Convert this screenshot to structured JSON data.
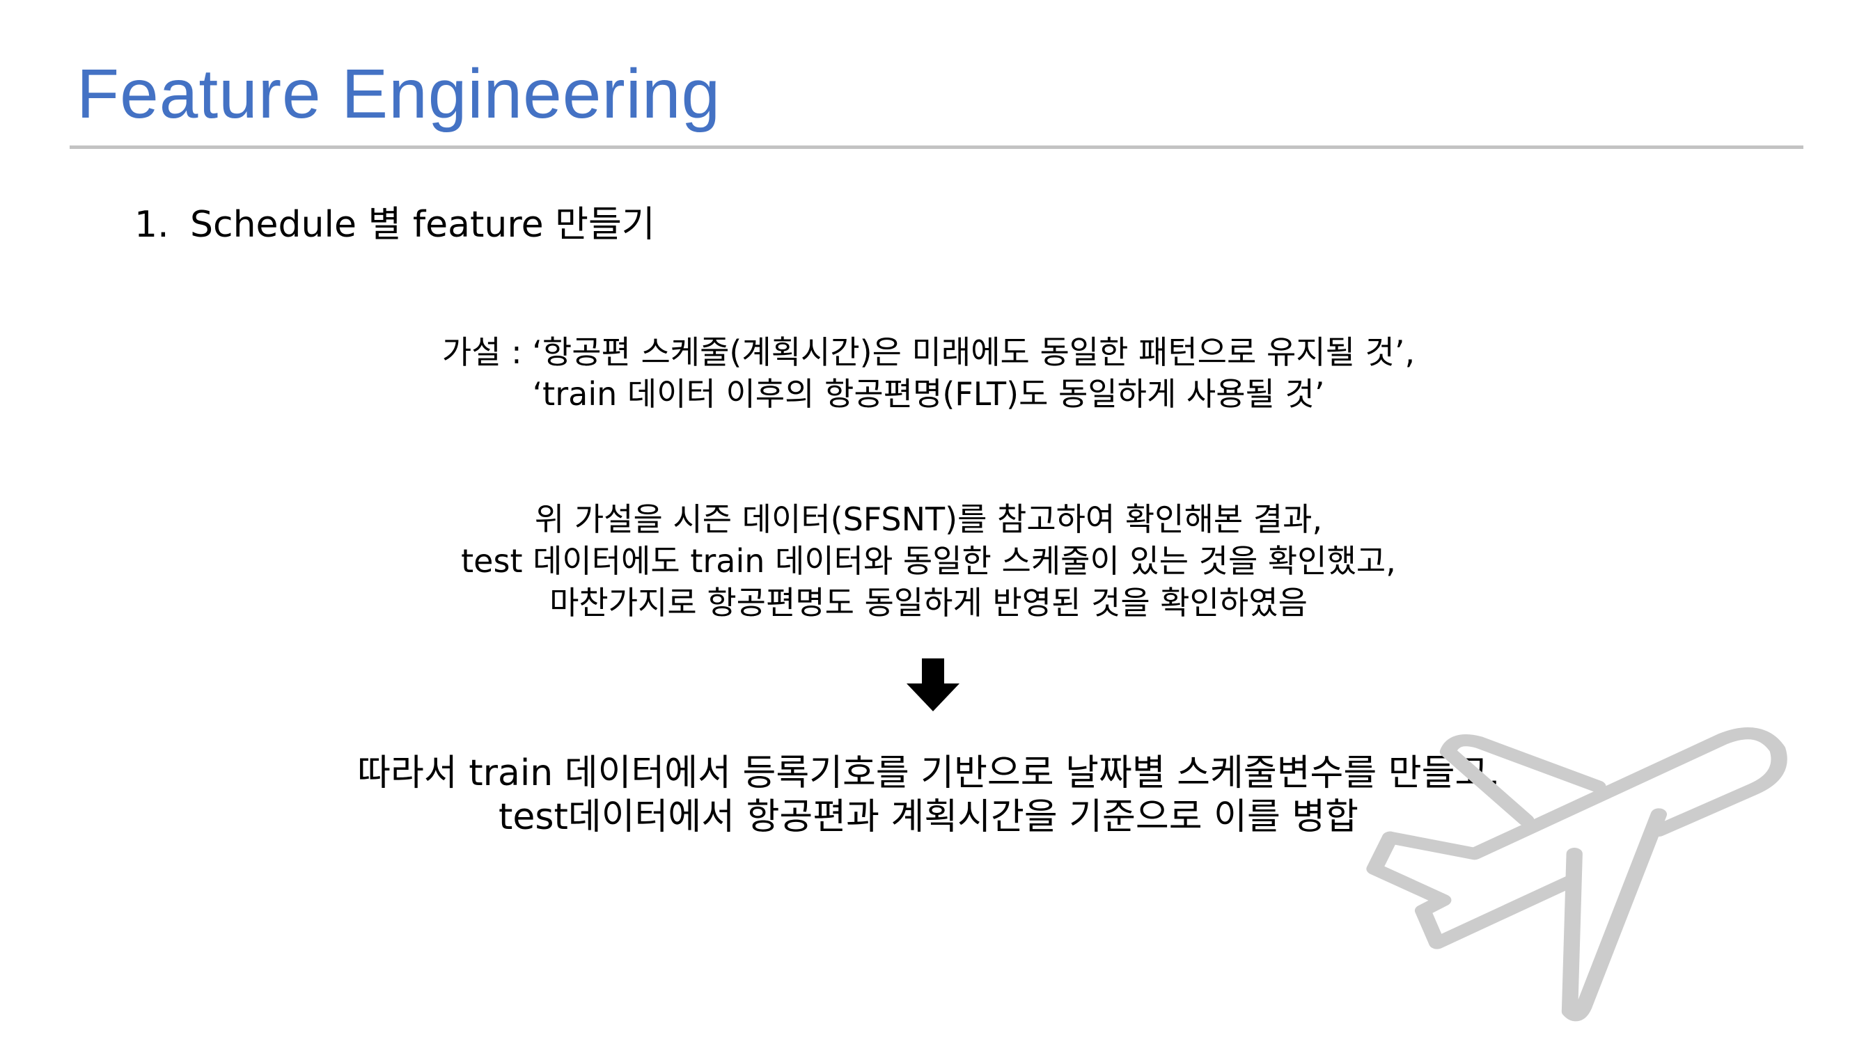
{
  "slide": {
    "title": "Feature Engineering",
    "accent_color": "#4472c4",
    "section": {
      "number": "1.",
      "label": "Schedule 별 feature 만들기"
    },
    "hypothesis": [
      "가설 : ‘항공편 스케줄(계획시간)은 미래에도 동일한 패턴으로 유지될 것’,",
      "‘train 데이터 이후의 항공편명(FLT)도 동일하게 사용될 것’"
    ],
    "findings": [
      "위 가설을 시즌 데이터(SFSNT)를 참고하여 확인해본 결과,",
      "test 데이터에도 train 데이터와 동일한 스케줄이 있는 것을 확인했고,",
      "마찬가지로 항공편명도 동일하게 반영된 것을 확인하였음"
    ],
    "arrow_icon": "arrow-down-icon",
    "conclusion": [
      "따라서 train 데이터에서 등록기호를 기반으로 날짜별 스케줄변수를 만들고,",
      "test데이터에서 항공편과 계획시간을 기준으로 이를 병합"
    ],
    "decoration_icon": "airplane-icon"
  }
}
